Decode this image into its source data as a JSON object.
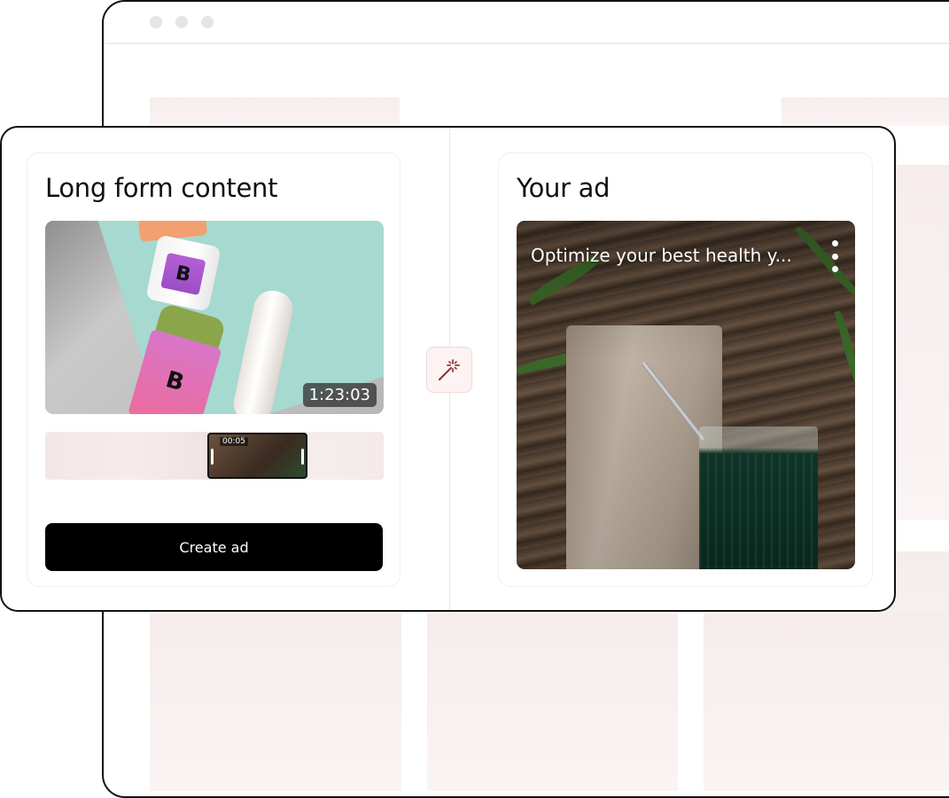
{
  "left_card": {
    "title": "Long form content",
    "video_duration": "1:23:03",
    "clip_timestamp": "00:05",
    "create_button_label": "Create ad"
  },
  "right_card": {
    "title": "Your ad",
    "ad_caption": "Optimize your best health y..."
  },
  "icons": {
    "magic": "magic-wand-icon",
    "menu": "more-vertical-icon"
  },
  "colors": {
    "button_bg": "#000000",
    "magic_button_bg": "#fdf3f3",
    "magic_icon": "#8a3b3b",
    "placeholder": "#f6ecec"
  }
}
